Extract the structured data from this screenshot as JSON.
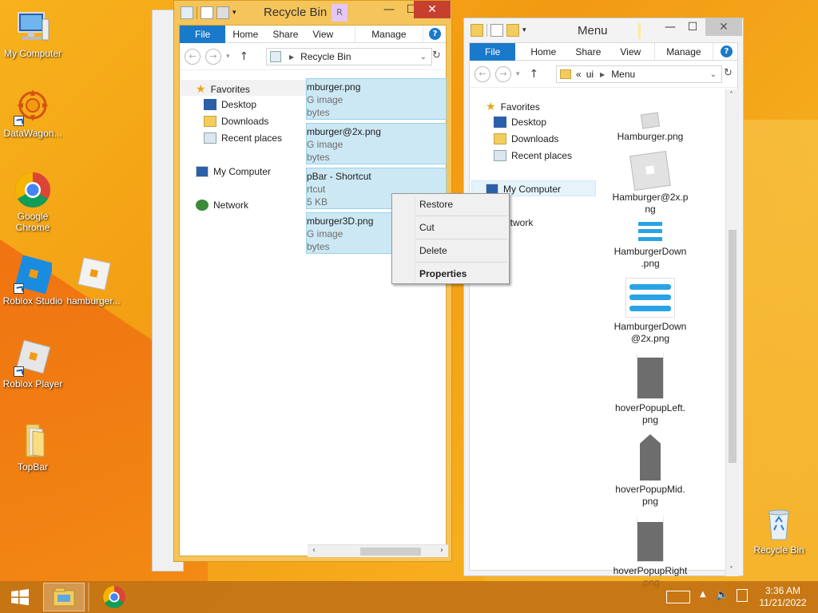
{
  "desktop": {
    "icons": [
      {
        "label": "My Computer"
      },
      {
        "label": "DataWagon..."
      },
      {
        "label": "Google Chrome"
      },
      {
        "label": "Roblox Studio"
      },
      {
        "label": "hamburger..."
      },
      {
        "label": "Roblox Player"
      },
      {
        "label": "TopBar"
      },
      {
        "label": "Recycle Bin"
      }
    ]
  },
  "recycle_window": {
    "title": "Recycle Bin",
    "title_tab": "R",
    "ribbon": {
      "file": "File",
      "home": "Home",
      "share": "Share",
      "view": "View",
      "manage": "Manage"
    },
    "address": {
      "path": "Recycle Bin"
    },
    "nav": {
      "favorites": "Favorites",
      "desktop": "Desktop",
      "downloads": "Downloads",
      "recent": "Recent places",
      "computer": "My Computer",
      "network": "Network"
    },
    "files": [
      {
        "name": "mburger.png",
        "type": "G image",
        "size": "bytes"
      },
      {
        "name": "mburger@2x.png",
        "type": "G image",
        "size": "bytes"
      },
      {
        "name": "pBar - Shortcut",
        "type": "rtcut",
        "size": "5 KB"
      },
      {
        "name": "mburger3D.png",
        "type": "G image",
        "size": "bytes"
      }
    ]
  },
  "context_menu": {
    "items": [
      "Restore",
      "Cut",
      "Delete",
      "Properties"
    ]
  },
  "menu_window": {
    "title": "Menu",
    "ribbon": {
      "file": "File",
      "home": "Home",
      "share": "Share",
      "view": "View",
      "manage": "Manage"
    },
    "address": {
      "prefix": "«",
      "seg1": "ui",
      "seg2": "Menu"
    },
    "nav": {
      "favorites": "Favorites",
      "desktop": "Desktop",
      "downloads": "Downloads",
      "recent": "Recent places",
      "computer": "My Computer",
      "network": "etwork"
    },
    "files": [
      {
        "line1": "Hamburger.png",
        "line2": ""
      },
      {
        "line1": "Hamburger@2x.p",
        "line2": "ng"
      },
      {
        "line1": "HamburgerDown",
        "line2": ".png"
      },
      {
        "line1": "HamburgerDown",
        "line2": "@2x.png"
      },
      {
        "line1": "hoverPopupLeft.",
        "line2": "png"
      },
      {
        "line1": "hoverPopupMid.",
        "line2": "png"
      },
      {
        "line1": "hoverPopupRight",
        "line2": ".png"
      }
    ]
  },
  "taskbar": {
    "time": "3:36 AM",
    "date": "11/21/2022"
  },
  "colors": {
    "accent": "#1979ca",
    "selection": "#cce8f4",
    "close": "#c7402f"
  }
}
